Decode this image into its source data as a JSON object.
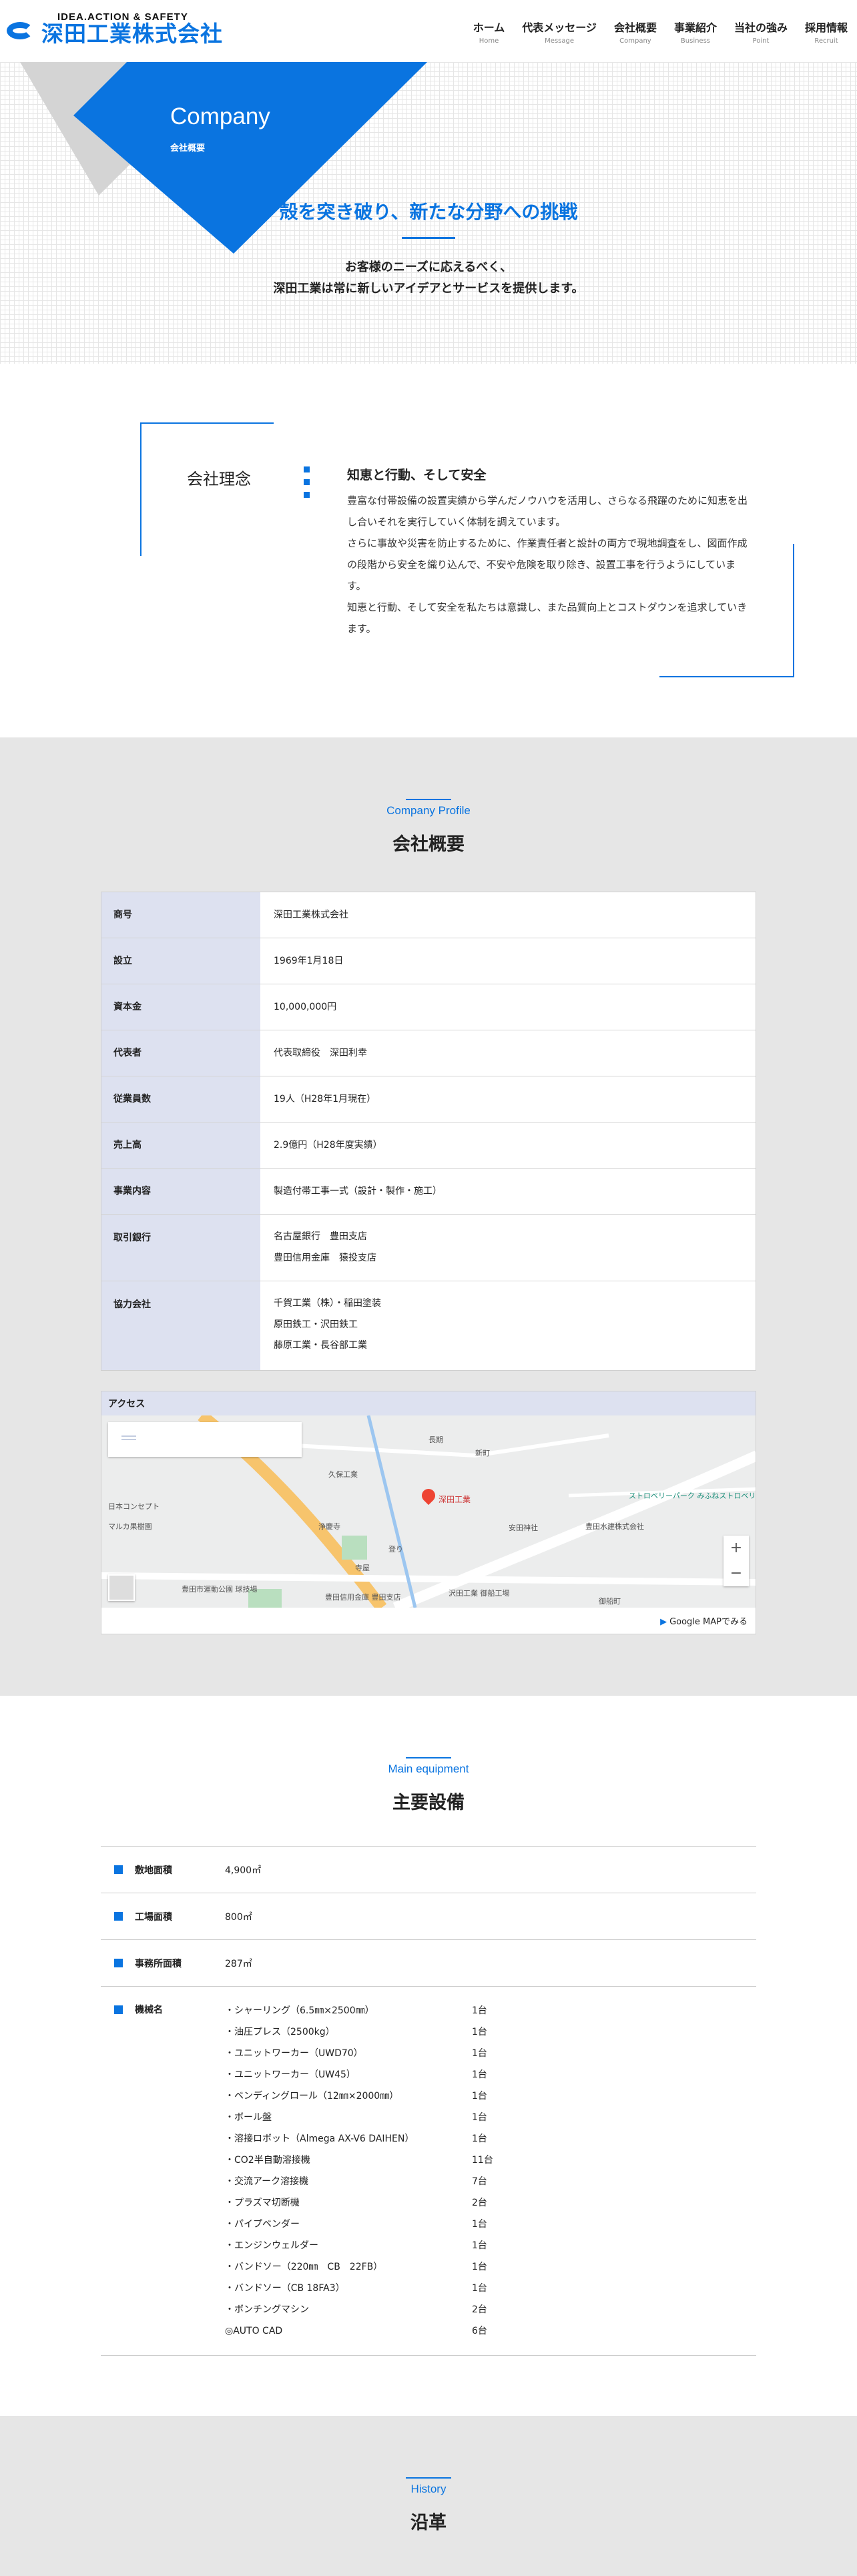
{
  "header": {
    "logo_sub": "IDEA.ACTION & SAFETY",
    "logo_main": "深田工業株式会社",
    "nav": [
      {
        "ja": "ホーム",
        "en": "Home"
      },
      {
        "ja": "代表メッセージ",
        "en": "Message"
      },
      {
        "ja": "会社概要",
        "en": "Company"
      },
      {
        "ja": "事業紹介",
        "en": "Business"
      },
      {
        "ja": "当社の強み",
        "en": "Point"
      },
      {
        "ja": "採用情報",
        "en": "Recruit"
      }
    ]
  },
  "hero": {
    "title_en": "Company",
    "title_ja": "会社概要",
    "catch": "殻を突き破り、新たな分野への挑戦",
    "desc_line1": "お客様のニーズに応えるべく、",
    "desc_line2": "深田工業は常に新しいアイデアとサービスを提供します。"
  },
  "philosophy": {
    "title": "会社理念",
    "heading": "知恵と行動、そして安全",
    "paragraphs": [
      "豊富な付帯設備の設置実績から学んだノウハウを活用し、さらなる飛躍のために知恵を出し合いそれを実行していく体制を調えています。",
      "さらに事故や災害を防止するために、作業責任者と設計の両方で現地調査をし、図面作成の段階から安全を織り込んで、不安や危険を取り除き、設置工事を行うようにしています。",
      "知恵と行動、そして安全を私たちは意識し、また品質向上とコストダウンを追求していきます。"
    ]
  },
  "profile": {
    "label_en": "Company Profile",
    "label_ja": "会社概要",
    "rows": [
      {
        "th": "商号",
        "td": [
          "深田工業株式会社"
        ]
      },
      {
        "th": "設立",
        "td": [
          "1969年1月18日"
        ]
      },
      {
        "th": "資本金",
        "td": [
          "10,000,000円"
        ]
      },
      {
        "th": "代表者",
        "td": [
          "代表取締役　深田利幸"
        ]
      },
      {
        "th": "従業員数",
        "td": [
          "19人（H28年1月現在）"
        ]
      },
      {
        "th": "売上高",
        "td": [
          "2.9億円（H28年度実績）"
        ]
      },
      {
        "th": "事業内容",
        "td": [
          "製造付帯工事一式（設計・製作・施工）"
        ]
      },
      {
        "th": "取引銀行",
        "td": [
          "名古屋銀行　豊田支店",
          "豊田信用金庫　猿投支店"
        ]
      },
      {
        "th": "協力会社",
        "td": [
          "千賀工業（株）・稲田塗装",
          "原田鉄工・沢田鉄工",
          "藤原工業・長谷部工業"
        ]
      }
    ],
    "access_label": "アクセス",
    "map": {
      "pin_label": "深田工業",
      "labels": [
        "久保工業",
        "日本コンセプト",
        "マルカ果樹園",
        "浄慶寺",
        "豊田市運動公園 球技場",
        "豊田信用金庫 豊田支店",
        "沢田工業 御船工場",
        "安田神社",
        "豊田水建株式会社",
        "ストロベリーパーク みふねストロベリー",
        "御船町",
        "長期",
        "新町",
        "登り",
        "寺屋"
      ],
      "zoom_in": "+",
      "zoom_out": "−"
    },
    "map_link": "Google MAPでみる"
  },
  "equipment": {
    "label_en": "Main equipment",
    "label_ja": "主要設備",
    "rows": [
      {
        "th": "敷地面積",
        "td": "4,900㎡"
      },
      {
        "th": "工場面積",
        "td": "800㎡"
      },
      {
        "th": "事務所面積",
        "td": "287㎡"
      }
    ],
    "machines_label": "機械名",
    "machines": [
      {
        "name": "・シャーリング（6.5㎜×2500㎜）",
        "qty": "1台"
      },
      {
        "name": "・油圧プレス（2500kg）",
        "qty": "1台"
      },
      {
        "name": "・ユニットワーカー（UWD70）",
        "qty": "1台"
      },
      {
        "name": "・ユニットワーカー（UW45）",
        "qty": "1台"
      },
      {
        "name": "・ベンディングロール（12㎜×2000㎜）",
        "qty": "1台"
      },
      {
        "name": "・ボール盤",
        "qty": "1台"
      },
      {
        "name": "・溶接ロボット（Almega AX-V6 DAIHEN）",
        "qty": "1台"
      },
      {
        "name": "・CO2半自動溶接機",
        "qty": "11台"
      },
      {
        "name": "・交流アーク溶接機",
        "qty": "7台"
      },
      {
        "name": "・プラズマ切断機",
        "qty": "2台"
      },
      {
        "name": "・パイプベンダー",
        "qty": "1台"
      },
      {
        "name": "・エンジンウェルダー",
        "qty": "1台"
      },
      {
        "name": "・バンドソー（220㎜　CB　22FB）",
        "qty": "1台"
      },
      {
        "name": "・バンドソー（CB 18FA3）",
        "qty": "1台"
      },
      {
        "name": "・ボンチングマシン",
        "qty": "2台"
      },
      {
        "name": "◎AUTO CAD",
        "qty": "6台"
      }
    ]
  },
  "history": {
    "label_en": "History",
    "label_ja": "沿革"
  },
  "colors": {
    "accent": "#0a74e0",
    "table_header": "#dde1f0",
    "section_gray": "#e6e6e6"
  }
}
